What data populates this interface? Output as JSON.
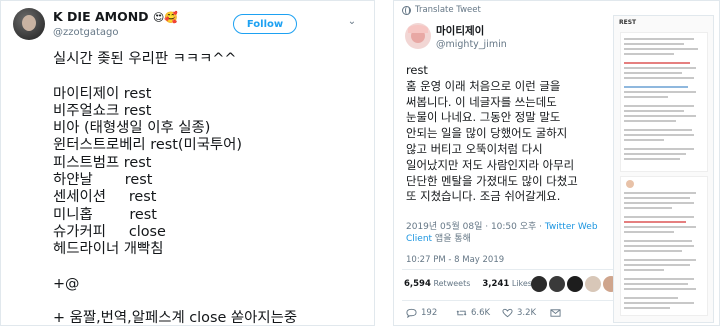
{
  "left_tweet": {
    "display_name": "K DIE AMOND",
    "name_emoji": "😍🥰",
    "handle": "@zzotgatago",
    "follow_label": "Follow",
    "body_lines": [
      "실시간 좆된 우리판 ㅋㅋㅋ^^",
      "",
      "마이티제이 rest",
      "비주얼쇼크 rest",
      "비아 (태형생일 이후 실종)",
      "윈터스트로베리 rest(미국투어)",
      "피스트범프 rest",
      "하얀날       rest",
      "센세이션     rest",
      "미니홉        rest",
      "슈가커피     close",
      "헤드라이너 개빡침",
      "",
      "+@",
      "",
      "+ 움짤,번역,알페스계 close 쏟아지는중"
    ]
  },
  "right_tweet": {
    "translate_label": "Translate Tweet",
    "display_name": "마이티제이",
    "handle": "@mighty_jimin",
    "body_lines": [
      "rest",
      "홈 운영 이래 처음으로 이런 글을",
      "써봅니다. 이 네글자를 쓰는데도",
      "눈물이 나네요. 그동안 정말 말도",
      "안되는 일을 많이 당했어도 굴하지",
      "않고 버티고 오뚝이처럼 다시",
      "일어났지만 저도 사람인지라 아무리",
      "단단한 멘탈을 가졌대도 많이 다쳤고",
      "또 지쳤습니다. 조금 쉬어갈게요."
    ],
    "meta_prefix": "2019년 05월 08일 · 10:50 오후 · ",
    "meta_link": "Twitter Web",
    "meta_link_2": "Client",
    "meta_suffix": " 앱을 통해",
    "date": "10:27 PM - 8 May 2019",
    "retweets_count": "6,594",
    "retweets_label": "Retweets",
    "likes_count": "3,241",
    "likes_label": "Likes",
    "reply_count": "192",
    "retweet_action_count": "6.6K",
    "like_action_count": "3.2K",
    "attached_image_title": "REST",
    "liker_colors": [
      "#2b2b2b",
      "#3a3a3a",
      "#1d1d1d",
      "#d8c7b8",
      "#cfa58d",
      "#6c5c52",
      "#b8a88f",
      "#a9b8a0",
      "#8e8e8e",
      "#c7b8ad"
    ]
  }
}
